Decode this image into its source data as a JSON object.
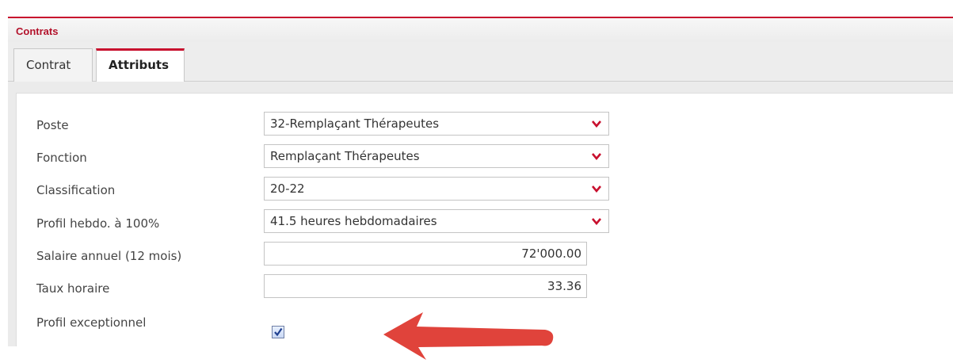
{
  "panel": {
    "title": "Contrats"
  },
  "tabs": [
    {
      "label": "Contrat"
    },
    {
      "label": "Attributs"
    }
  ],
  "form": {
    "poste": {
      "label": "Poste",
      "value": "32-Remplaçant Thérapeutes"
    },
    "fonction": {
      "label": "Fonction",
      "value": "Remplaçant Thérapeutes"
    },
    "classification": {
      "label": "Classification",
      "value": "20-22"
    },
    "profil_hebdo": {
      "label": "Profil hebdo. à 100%",
      "value": "41.5 heures hebdomadaires"
    },
    "salaire": {
      "label": "Salaire annuel (12 mois)",
      "value": "72'000.00"
    },
    "taux": {
      "label": "Taux horaire",
      "value": "33.36"
    },
    "profil_exceptionnel": {
      "label": "Profil exceptionnel",
      "checked": true
    }
  },
  "colors": {
    "accent": "#c8102e",
    "annotation_arrow": "#e0433b",
    "checkbox_mark": "#1f3f8f"
  },
  "icons": {
    "dropdown": "chevron-down-icon",
    "checkbox": "checkmark-icon",
    "annotation": "arrow-left-icon"
  }
}
